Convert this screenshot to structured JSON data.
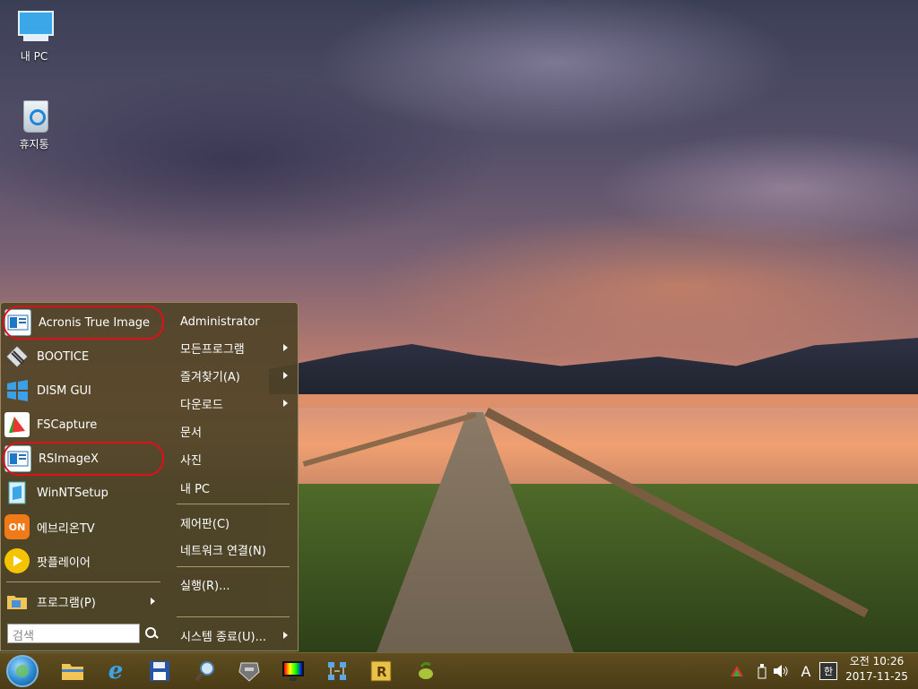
{
  "desktop": {
    "icons": [
      {
        "label": "내 PC",
        "icon": "computer-icon"
      },
      {
        "label": "휴지통",
        "icon": "recycle-bin-icon"
      }
    ]
  },
  "start_menu": {
    "pinned": [
      {
        "label": "Acronis True Image",
        "icon": "acronis-icon",
        "highlighted": true
      },
      {
        "label": "BOOTICE",
        "icon": "bootice-icon",
        "highlighted": false
      },
      {
        "label": "DISM GUI",
        "icon": "windows-flag-icon",
        "highlighted": false
      },
      {
        "label": "FSCapture",
        "icon": "fscapture-icon",
        "highlighted": false
      },
      {
        "label": "RSImageX",
        "icon": "rsimagex-icon",
        "highlighted": true
      },
      {
        "label": "WinNTSetup",
        "icon": "winntsetup-icon",
        "highlighted": false
      },
      {
        "label": "에브리온TV",
        "icon": "everyon-tv-icon",
        "highlighted": false
      },
      {
        "label": "팟플레이어",
        "icon": "potplayer-icon",
        "highlighted": false
      }
    ],
    "programs_label": "프로그램(P)",
    "search_placeholder": "검색",
    "right": {
      "user": "Administrator",
      "all_programs": "모든프로그램",
      "favorites": "즐겨찾기(A)",
      "downloads": "다운로드",
      "documents": "문서",
      "pictures": "사진",
      "my_pc": "내 PC",
      "control_panel": "제어판(C)",
      "network": "네트워크 연결(N)",
      "run": "실행(R)...",
      "shutdown": "시스템 종료(U)..."
    }
  },
  "taskbar": {
    "pinned": [
      "file-explorer-icon",
      "internet-explorer-icon",
      "save-floppy-icon",
      "search-magnifier-icon",
      "transformer-app-icon",
      "color-monitor-icon",
      "network-tool-icon",
      "r-app-icon",
      "olive-app-icon"
    ],
    "tray": {
      "input_mode": "A",
      "ime": "한"
    },
    "clock": {
      "time": "오전 10:26",
      "date": "2017-11-25"
    }
  },
  "colors": {
    "taskbar": "#4a3c16",
    "menu": "#50442a",
    "highlight_ring": "#e0101a"
  }
}
